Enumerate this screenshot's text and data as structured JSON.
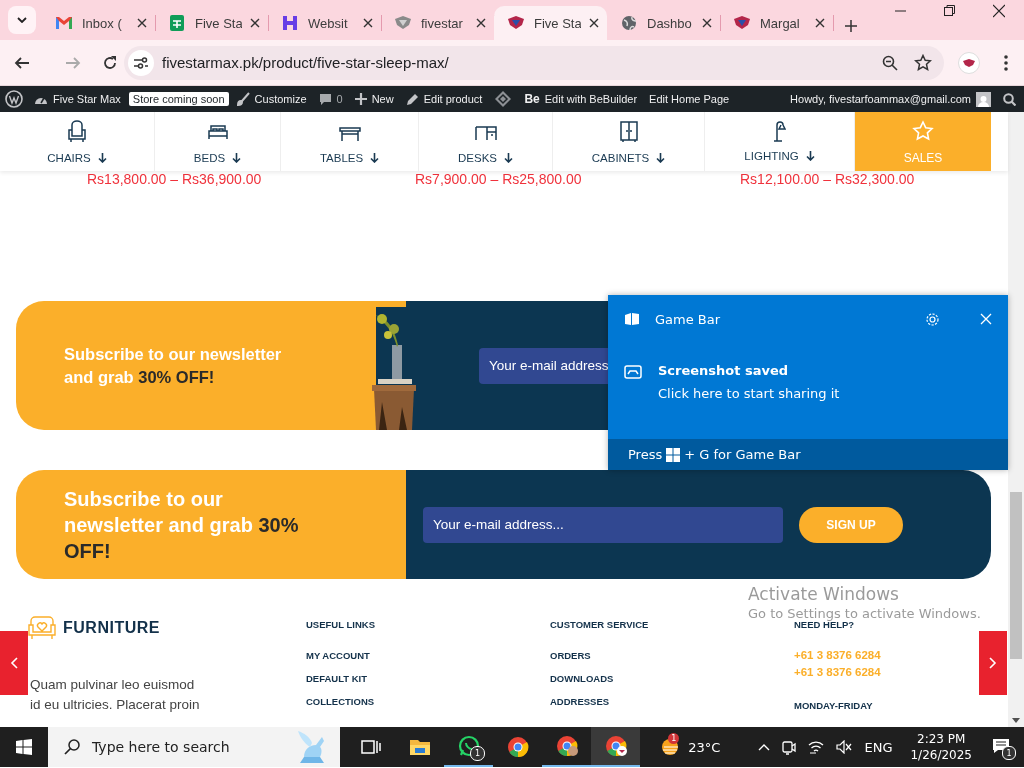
{
  "browser": {
    "tabs": [
      {
        "title": "Inbox (",
        "selected": false
      },
      {
        "title": "Five Sta",
        "selected": false
      },
      {
        "title": "Websit",
        "selected": false
      },
      {
        "title": "fivestar",
        "selected": false
      },
      {
        "title": "Five Sta",
        "selected": true
      },
      {
        "title": "Dashbo",
        "selected": false
      },
      {
        "title": "Margal",
        "selected": false
      }
    ],
    "address": "fivestarmax.pk/product/five-star-sleep-max/"
  },
  "admin_bar": {
    "site": "Five Star Max",
    "badge": "Store coming soon",
    "customize": "Customize",
    "comments": "0",
    "new": "New",
    "edit_product": "Edit product",
    "be_logo": "Be",
    "bebuilder": "Edit with BeBuilder",
    "edit_home": "Edit Home Page",
    "howdy": "Howdy, fivestarfoammax@gmail.com"
  },
  "category_nav": [
    {
      "label": "CHAIRS",
      "dropdown": true,
      "selected": false
    },
    {
      "label": "BEDS",
      "dropdown": true,
      "selected": false
    },
    {
      "label": "TABLES",
      "dropdown": true,
      "selected": false
    },
    {
      "label": "DESKS",
      "dropdown": true,
      "selected": false
    },
    {
      "label": "CABINETS",
      "dropdown": true,
      "selected": false
    },
    {
      "label": "LIGHTING",
      "dropdown": true,
      "selected": false
    },
    {
      "label": "SALES",
      "dropdown": false,
      "selected": true
    }
  ],
  "prices": [
    "Rs13,800.00 – Rs36,900.00",
    "Rs7,900.00 – Rs25,800.00",
    "Rs12,100.00 – Rs32,300.00"
  ],
  "newsletters": [
    {
      "kind": "picture",
      "heading": "Subscribe to our newsletter and grab",
      "highlight": "30% OFF!",
      "placeholder": "Your e-mail address"
    },
    {
      "kind": "button",
      "heading": "Subscribe to our newsletter and grab",
      "highlight": "30% OFF!",
      "placeholder": "Your e-mail address...",
      "button": "SIGN UP"
    }
  ],
  "footer": {
    "brand": "FURNITURE",
    "text": "Quam pulvinar leo euismod id eu ultricies. Placerat proin",
    "columns": [
      {
        "title": "USEFUL LINKS",
        "links": [
          "MY ACCOUNT",
          "DEFAULT KIT",
          "COLLECTIONS"
        ]
      },
      {
        "title": "CUSTOMER SERVICE",
        "links": [
          "ORDERS",
          "DOWNLOADS",
          "ADDRESSES"
        ]
      },
      {
        "title": "NEED HELP?",
        "links": [
          "+61 3 8376 6284",
          "+61 3 8376 6284"
        ],
        "subtitle": "MONDAY-FRIDAY"
      }
    ]
  },
  "activation": {
    "title": "Activate Windows",
    "subtitle": "Go to Settings to activate Windows."
  },
  "game_bar": {
    "title": "Game Bar",
    "notification_title": "Screenshot saved",
    "notification_text": "Click here to start sharing it",
    "hint_before": "Press",
    "hint_after": "+ G for Game Bar"
  },
  "taskbar": {
    "search_placeholder": "Type here to search",
    "apps": [
      {
        "running": false,
        "selected": false
      },
      {
        "running": false,
        "selected": false
      },
      {
        "running": true,
        "selected": false,
        "badge": "1"
      },
      {
        "running": false,
        "selected": false
      },
      {
        "running": true,
        "selected": false
      },
      {
        "running": true,
        "selected": true
      }
    ],
    "weather": {
      "temperature": "23°C",
      "badge": "1"
    },
    "language": "ENG",
    "time": "2:23 PM",
    "date": "1/26/2025",
    "notifications": "1"
  }
}
